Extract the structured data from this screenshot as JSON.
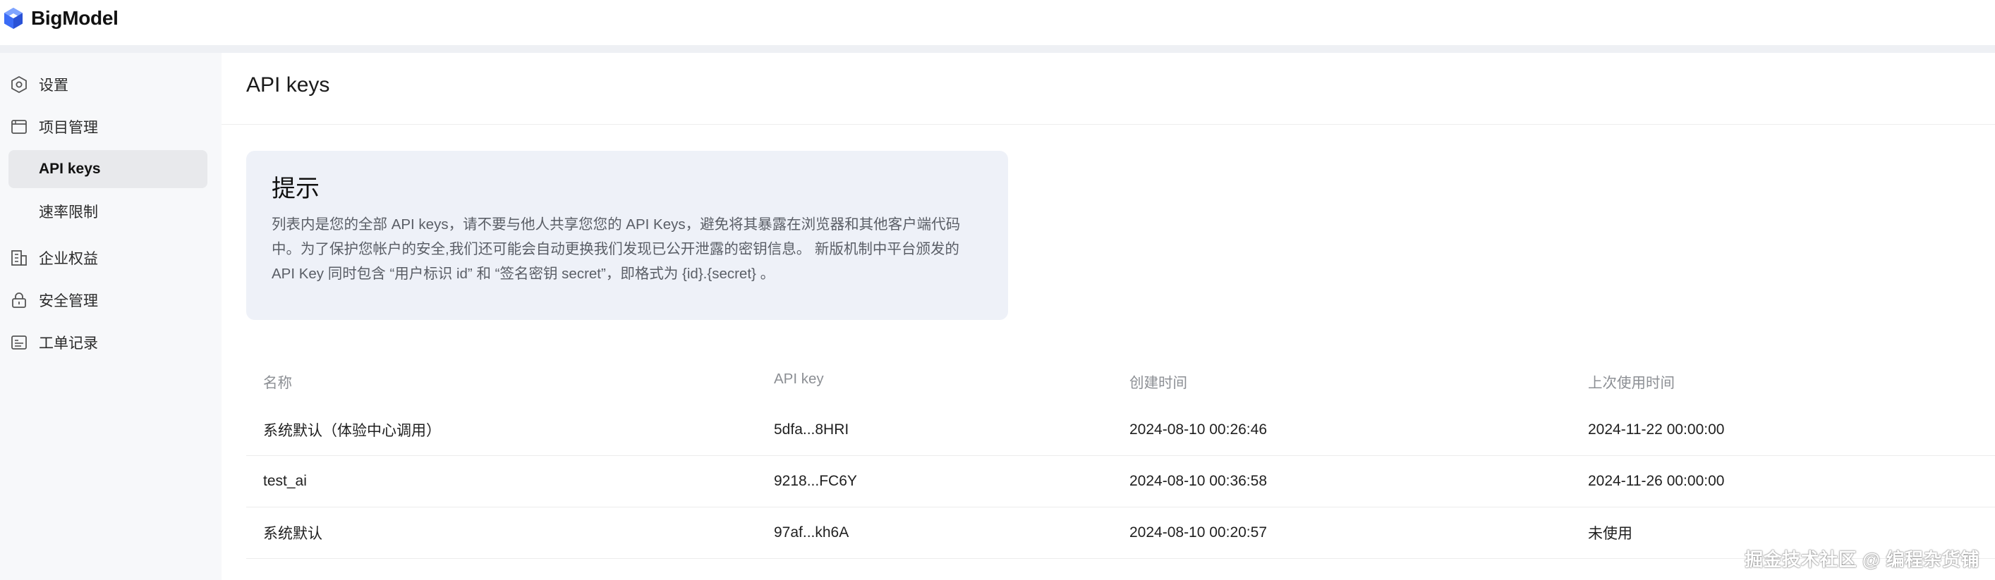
{
  "app": {
    "brand_name": "BigModel",
    "brand_color": "#3b6cf6",
    "logo_icon": "hexagon-cube-logo"
  },
  "sidebar": {
    "items": [
      {
        "label": "设置",
        "icon": "settings-hexagon-icon"
      },
      {
        "label": "项目管理",
        "icon": "folder-window-icon"
      },
      {
        "label": "API keys",
        "active": true
      },
      {
        "label": "速率限制"
      },
      {
        "label": "企业权益",
        "icon": "building-icon"
      },
      {
        "label": "安全管理",
        "icon": "lock-icon"
      },
      {
        "label": "工单记录",
        "icon": "ticket-list-icon"
      }
    ],
    "active_color": "#e8e9ec"
  },
  "main": {
    "title": "API keys",
    "tip": {
      "title": "提示",
      "body": "列表内是您的全部 API keys，请不要与他人共享您您的 API Keys，避免将其暴露在浏览器和其他客户端代码中。为了保护您帐户的安全,我们还可能会自动更换我们发现已公开泄露的密钥信息。 新版机制中平台颁发的 API Key 同时包含 “用户标识 id” 和 “签名密钥 secret”，即格式为 {id}.{secret} 。"
    },
    "table": {
      "headers": [
        "名称",
        "API key",
        "创建时间",
        "上次使用时间"
      ],
      "rows": [
        [
          "系统默认（体验中心调用）",
          "5dfa...8HRI",
          "2024-08-10 00:26:46",
          "2024-11-22 00:00:00"
        ],
        [
          "test_ai",
          "9218...FC6Y",
          "2024-08-10 00:36:58",
          "2024-11-26 00:00:00"
        ],
        [
          "系统默认",
          "97af...kh6A",
          "2024-08-10 00:20:57",
          "未使用"
        ]
      ]
    }
  },
  "watermark": "掘金技术社区 @ 编程杂货铺"
}
